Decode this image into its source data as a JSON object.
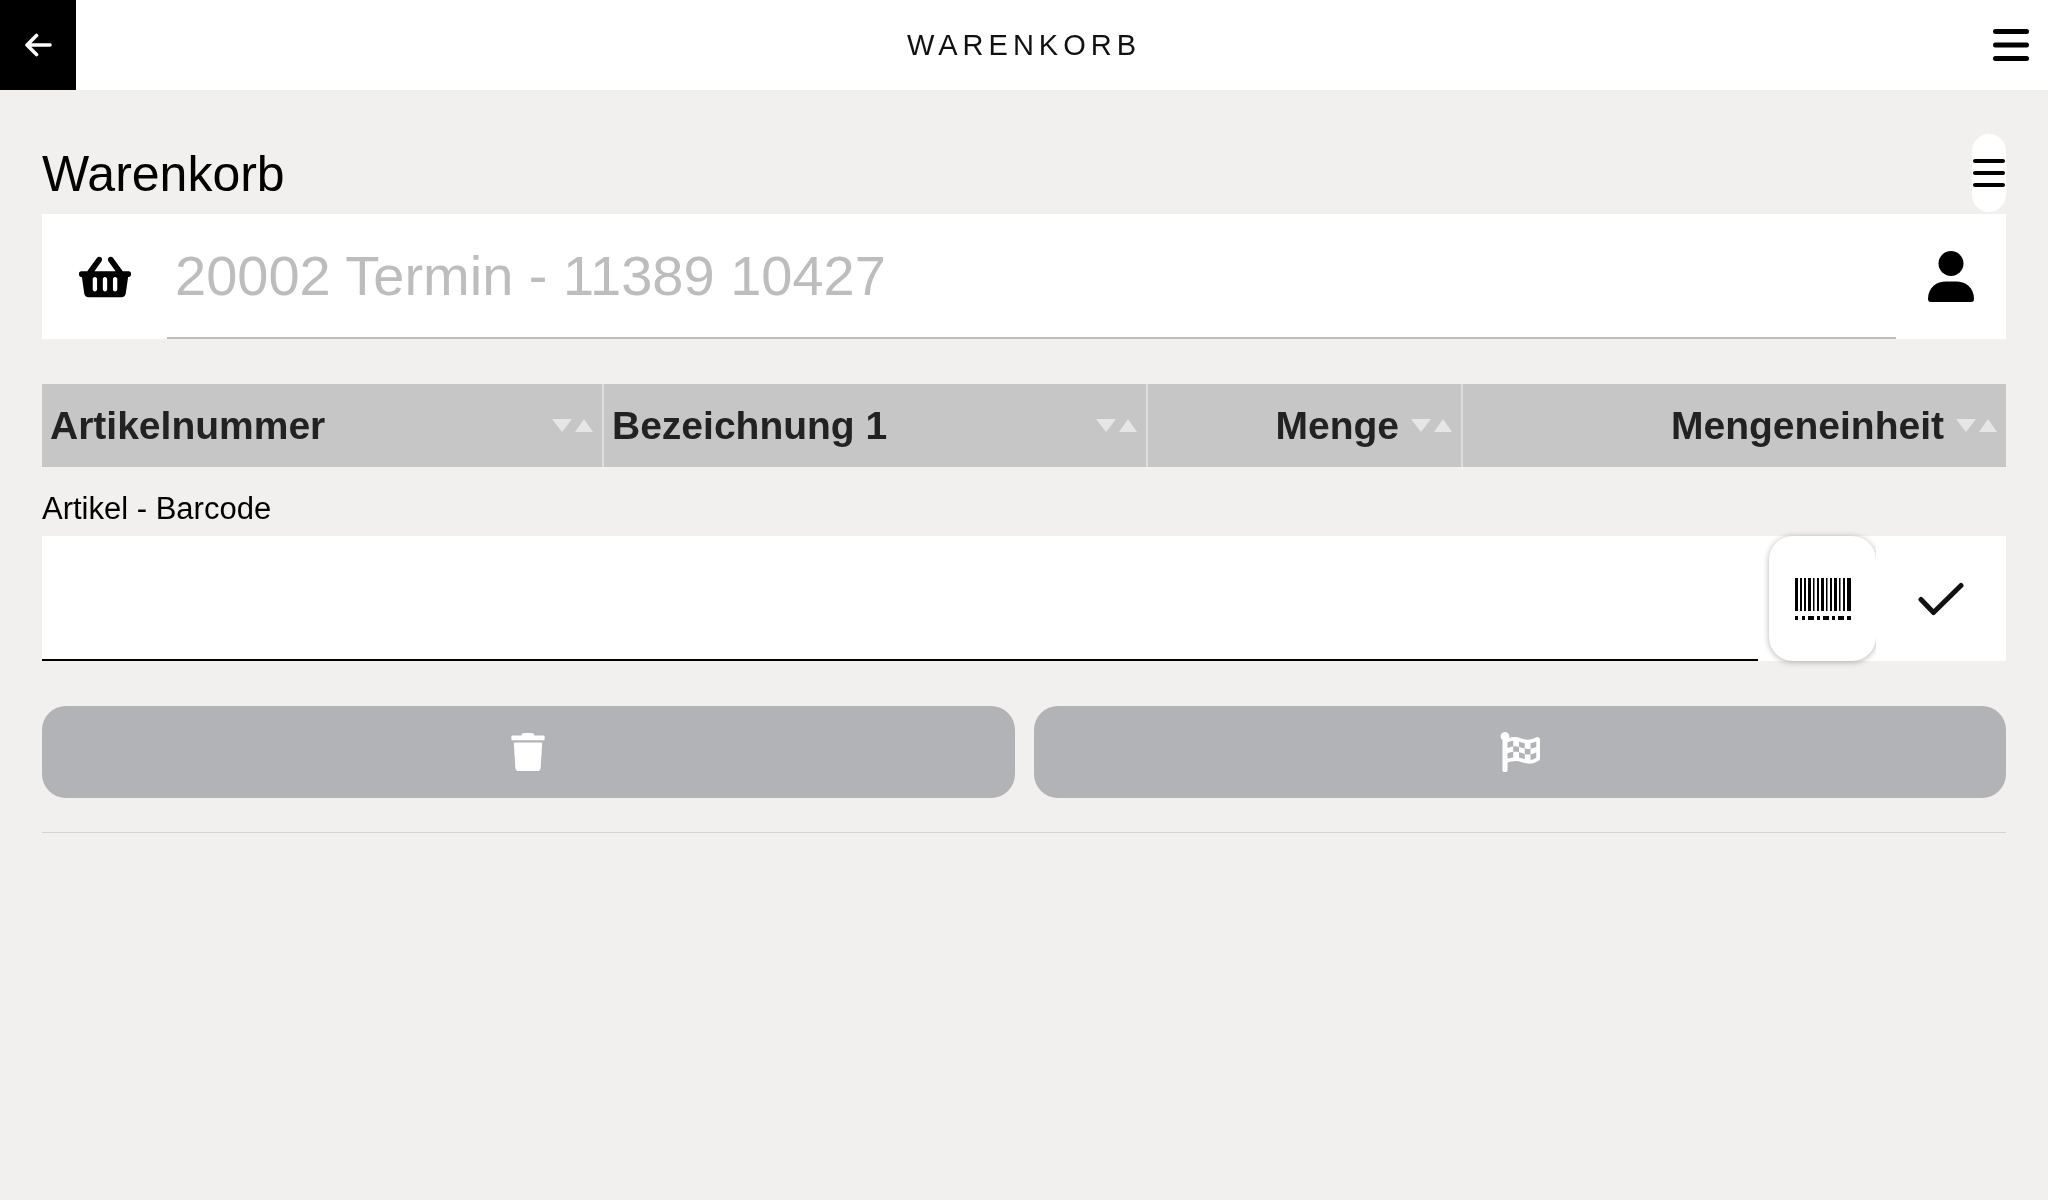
{
  "app_bar": {
    "title": "WARENKORB"
  },
  "page_title": "Warenkorb",
  "cart_field": {
    "value": "20002 Termin - 11389 10427",
    "disabled": true
  },
  "table": {
    "columns": [
      {
        "label": "Artikelnummer"
      },
      {
        "label": "Bezeichnung 1"
      },
      {
        "label": "Menge"
      },
      {
        "label": "Mengeneinheit"
      }
    ]
  },
  "barcode_field": {
    "label": "Artikel - Barcode"
  },
  "actions": [
    {
      "kind": "delete",
      "disabled": true
    },
    {
      "kind": "finish",
      "disabled": true
    }
  ]
}
